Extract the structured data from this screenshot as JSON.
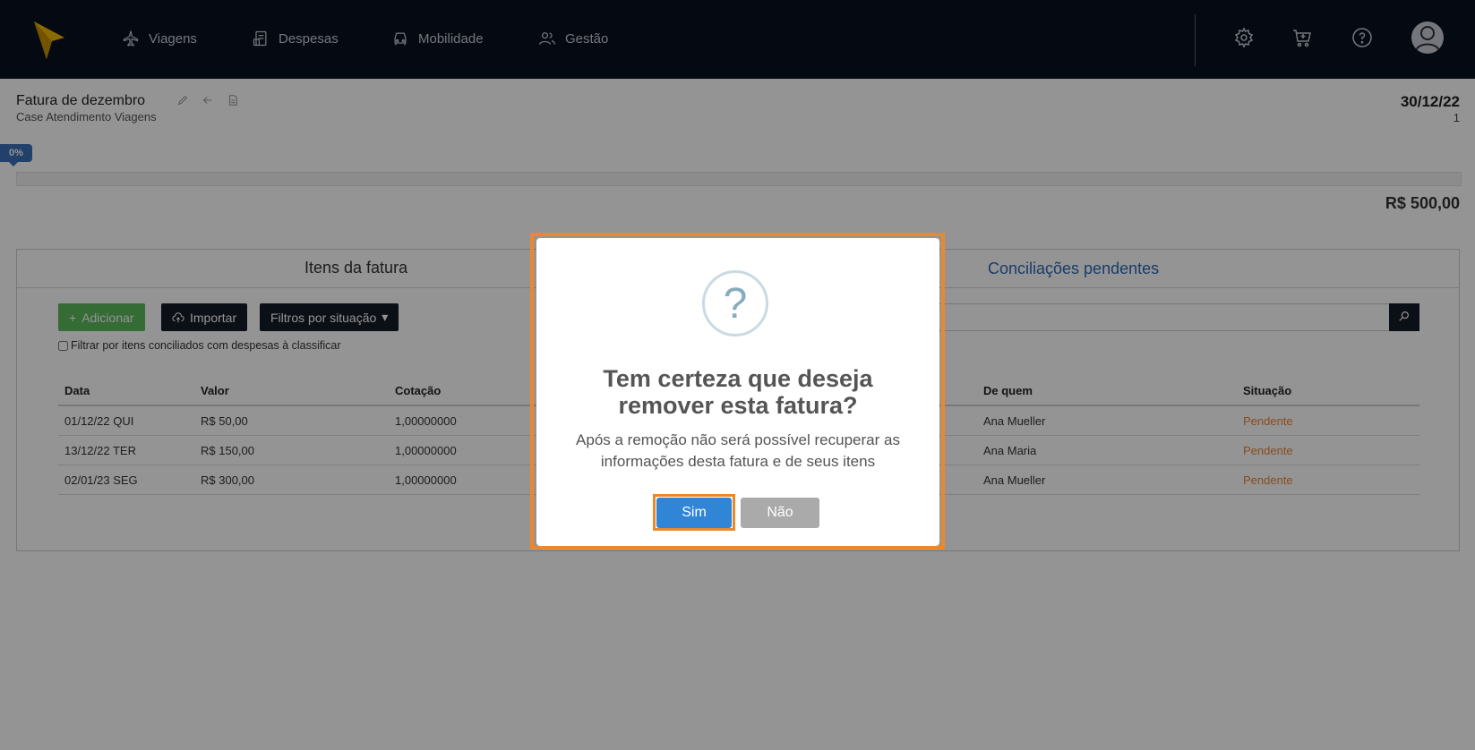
{
  "nav": {
    "items": [
      {
        "label": "Viagens",
        "icon": "airplane-icon"
      },
      {
        "label": "Despesas",
        "icon": "receipt-icon"
      },
      {
        "label": "Mobilidade",
        "icon": "car-icon"
      },
      {
        "label": "Gestão",
        "icon": "users-icon"
      }
    ],
    "right_icons": [
      "gear-icon",
      "cart-icon",
      "help-icon",
      "user-avatar"
    ]
  },
  "invoice": {
    "title": "Fatura de dezembro",
    "subtitle": "Case Atendimento Viagens",
    "date": "30/12/22",
    "number": "1",
    "progress_label": "0%",
    "progress_value": 0,
    "total": "R$ 500,00"
  },
  "tabs": {
    "items": "Itens da fatura",
    "reconciliations": "Conciliações pendentes"
  },
  "toolbar": {
    "add_label": "Adicionar",
    "import_label": "Importar",
    "filter_label": "Filtros por situação",
    "checkbox_label": "Filtrar por itens conciliados com despesas à classificar"
  },
  "table": {
    "headers": [
      "Data",
      "Valor",
      "Cotação",
      "De quem",
      "Situação"
    ],
    "rows": [
      {
        "date": "01/12/22 QUI",
        "value": "R$ 50,00",
        "rate": "1,00000000",
        "from": "Ana Mueller",
        "status": "Pendente"
      },
      {
        "date": "13/12/22 TER",
        "value": "R$ 150,00",
        "rate": "1,00000000",
        "from": "Ana Maria",
        "status": "Pendente"
      },
      {
        "date": "02/01/23 SEG",
        "value": "R$ 300,00",
        "rate": "1,00000000",
        "from": "Ana Mueller",
        "status": "Pendente"
      }
    ]
  },
  "modal": {
    "icon": "?",
    "title_line1": "Tem certeza que deseja",
    "title_line2": "remover esta fatura?",
    "text_line1": "Após a remoção não será possível recuperar as",
    "text_line2": "informações desta fatura e de seus itens",
    "confirm_label": "Sim",
    "cancel_label": "Não"
  },
  "colors": {
    "topbar": "#0a1220",
    "accent_blue": "#3085d6",
    "highlight_orange": "#e9892f",
    "status_pending": "#e8843a",
    "add_green": "#5cb85c"
  }
}
